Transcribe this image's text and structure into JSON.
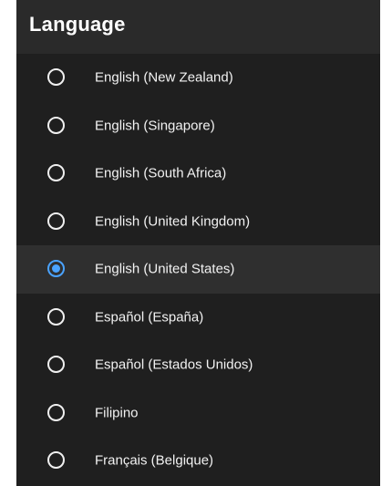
{
  "header": {
    "title": "Language"
  },
  "languages": [
    {
      "label": "English (New Zealand)",
      "selected": false
    },
    {
      "label": "English (Singapore)",
      "selected": false
    },
    {
      "label": "English (South Africa)",
      "selected": false
    },
    {
      "label": "English (United Kingdom)",
      "selected": false
    },
    {
      "label": "English (United States)",
      "selected": true
    },
    {
      "label": "Español (España)",
      "selected": false
    },
    {
      "label": "Español (Estados Unidos)",
      "selected": false
    },
    {
      "label": "Filipino",
      "selected": false
    },
    {
      "label": "Français (Belgique)",
      "selected": false
    }
  ],
  "colors": {
    "panel_background": "#1f1f1f",
    "header_background": "#2a2a2a",
    "selected_row_background": "#2f2f2f",
    "accent": "#4aa3ff",
    "text": "#f2f2f2"
  },
  "icons": {
    "unselected": "radio-unchecked-icon",
    "selected": "radio-checked-icon"
  }
}
